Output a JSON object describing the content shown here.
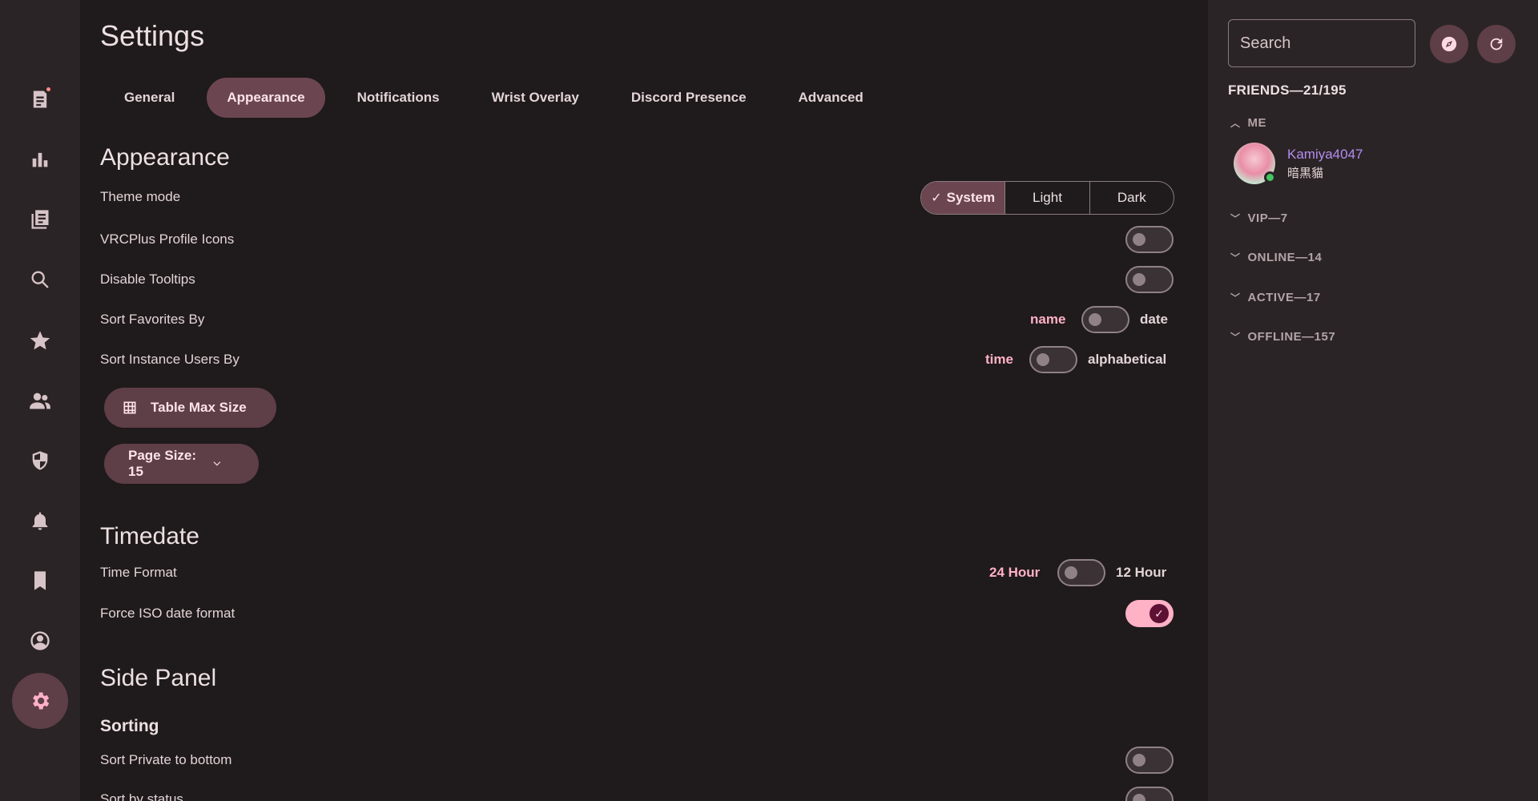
{
  "nav": {
    "items": [
      {
        "icon": "feed-icon",
        "name": "nav-feed",
        "dot": true
      },
      {
        "icon": "chart-icon",
        "name": "nav-charts"
      },
      {
        "icon": "gamelog-icon",
        "name": "nav-gamelog"
      },
      {
        "icon": "search-icon",
        "name": "nav-search"
      },
      {
        "icon": "star-icon",
        "name": "nav-favorites"
      },
      {
        "icon": "people-icon",
        "name": "nav-friends"
      },
      {
        "icon": "shield-icon",
        "name": "nav-moderation"
      },
      {
        "icon": "bell-icon",
        "name": "nav-notifications"
      },
      {
        "icon": "bookmark-icon",
        "name": "nav-bookmarks"
      },
      {
        "icon": "profile-icon",
        "name": "nav-profile"
      },
      {
        "icon": "gear-icon",
        "name": "nav-settings",
        "active": true
      }
    ],
    "accent": "#ffb1c6"
  },
  "header": {
    "title": "Settings",
    "tabs": [
      {
        "label": "General"
      },
      {
        "label": "Appearance",
        "active": true
      },
      {
        "label": "Notifications"
      },
      {
        "label": "Wrist Overlay"
      },
      {
        "label": "Discord Presence"
      },
      {
        "label": "Advanced"
      }
    ]
  },
  "appearance": {
    "title": "Appearance",
    "theme_mode": {
      "label": "Theme mode",
      "options": [
        "System",
        "Light",
        "Dark"
      ],
      "selected": "System"
    },
    "vrcplus_icons": {
      "label": "VRCPlus Profile Icons",
      "on": false
    },
    "disable_tooltips": {
      "label": "Disable Tooltips",
      "on": false
    },
    "sort_favorites": {
      "label": "Sort Favorites By",
      "left": "name",
      "right": "date",
      "on": false
    },
    "sort_instance_users": {
      "label": "Sort Instance Users By",
      "left": "time",
      "right": "alphabetical",
      "on": false
    },
    "table_max_size_button": "Table Max Size",
    "page_size_button": "Page Size: 15"
  },
  "timedate": {
    "title": "Timedate",
    "time_format": {
      "label": "Time Format",
      "left": "24 Hour",
      "right": "12 Hour",
      "on": false
    },
    "force_iso": {
      "label": "Force ISO date format",
      "on": true
    }
  },
  "side_panel": {
    "title": "Side Panel",
    "sorting_title": "Sorting",
    "sort_private_bottom": {
      "label": "Sort Private to bottom",
      "on": false
    },
    "sort_by_status": {
      "label": "Sort by status",
      "on": false
    }
  },
  "sidebar": {
    "search_placeholder": "Search",
    "friends_header": "FRIENDS—21/195",
    "groups": [
      {
        "label": "ME",
        "expanded": true
      },
      {
        "label": "VIP—7",
        "expanded": false
      },
      {
        "label": "ONLINE—14",
        "expanded": false
      },
      {
        "label": "ACTIVE—17",
        "expanded": false
      },
      {
        "label": "OFFLINE—157",
        "expanded": false
      }
    ],
    "me": {
      "name": "Kamiya4047",
      "status": "暗黒貓",
      "online": true
    }
  }
}
